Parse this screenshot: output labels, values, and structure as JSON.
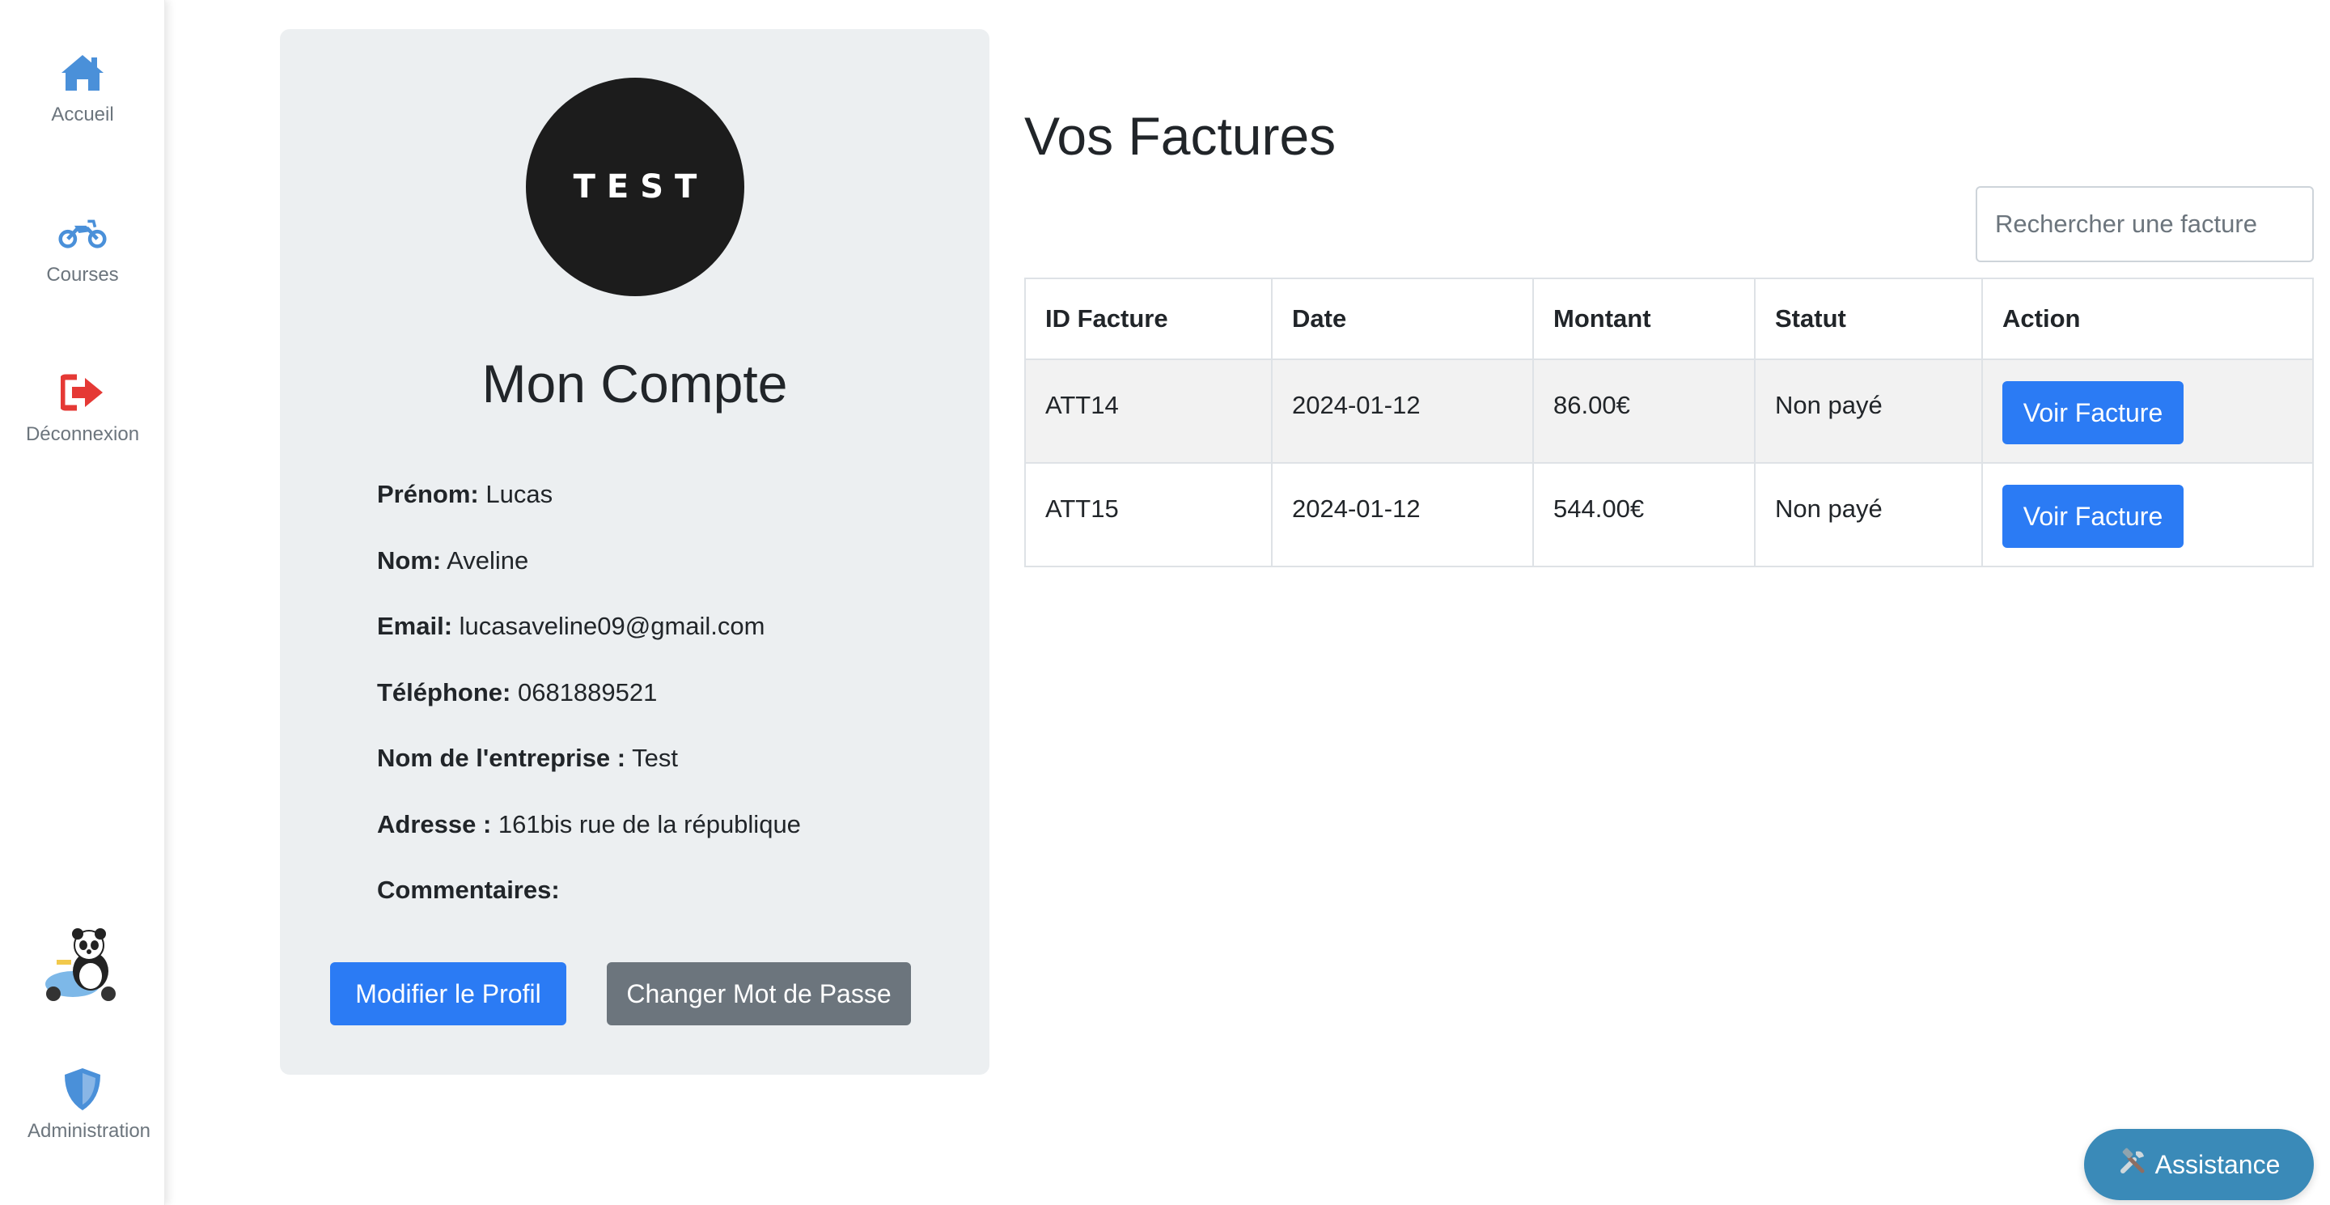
{
  "sidebar": {
    "items": [
      {
        "label": "Accueil",
        "icon": "home-icon",
        "color": "#4a90d9"
      },
      {
        "label": "Courses",
        "icon": "motorcycle-icon",
        "color": "#4a90d9"
      },
      {
        "label": "Déconnexion",
        "icon": "logout-icon",
        "color": "#e53935"
      },
      {
        "label": "Administration",
        "icon": "shield-icon",
        "color": "#4a90d9"
      }
    ],
    "mascot_icon": "panda-scooter-icon"
  },
  "profile": {
    "logo_text": "TEST",
    "title": "Mon Compte",
    "fields": [
      {
        "label": "Prénom:",
        "value": "Lucas"
      },
      {
        "label": "Nom:",
        "value": "Aveline"
      },
      {
        "label": "Email:",
        "value": "lucasaveline09@gmail.com"
      },
      {
        "label": "Téléphone:",
        "value": "0681889521"
      },
      {
        "label": "Nom de l'entreprise :",
        "value": "Test"
      },
      {
        "label": "Adresse :",
        "value": "161bis rue de la république"
      },
      {
        "label": "Commentaires:",
        "value": ""
      }
    ],
    "edit_button": "Modifier le Profil",
    "password_button": "Changer Mot de Passe"
  },
  "invoices": {
    "title": "Vos Factures",
    "search_placeholder": "Rechercher une facture",
    "columns": [
      "ID Facture",
      "Date",
      "Montant",
      "Statut",
      "Action"
    ],
    "rows": [
      {
        "id": "ATT14",
        "date": "2024-01-12",
        "amount": "86.00€",
        "status": "Non payé",
        "action": "Voir Facture"
      },
      {
        "id": "ATT15",
        "date": "2024-01-12",
        "amount": "544.00€",
        "status": "Non payé",
        "action": "Voir Facture"
      }
    ]
  },
  "assistance": {
    "label": "Assistance",
    "icon": "tools-icon"
  },
  "colors": {
    "primary": "#2b7bf4",
    "secondary": "#6c757d",
    "card_bg": "#eceff1",
    "assistance_bg": "#3a8ab8"
  }
}
